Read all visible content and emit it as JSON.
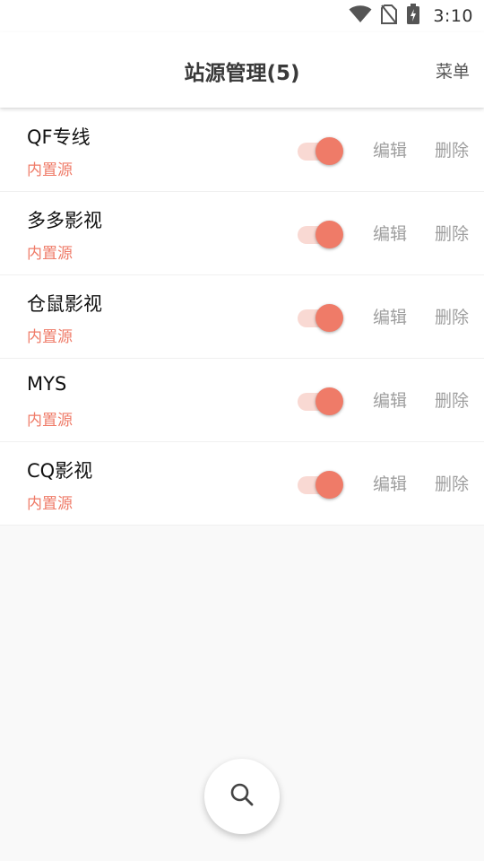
{
  "status_bar": {
    "time": "3:10",
    "icons": [
      "wifi-icon",
      "no-sim-icon",
      "battery-charging-icon"
    ]
  },
  "app_bar": {
    "title": "站源管理(5)",
    "menu_label": "菜单"
  },
  "sources": [
    {
      "name": "QF专线",
      "tag": "内置源",
      "enabled": true,
      "edit_label": "编辑",
      "delete_label": "删除"
    },
    {
      "name": "多多影视",
      "tag": "内置源",
      "enabled": true,
      "edit_label": "编辑",
      "delete_label": "删除"
    },
    {
      "name": "仓鼠影视",
      "tag": "内置源",
      "enabled": true,
      "edit_label": "编辑",
      "delete_label": "删除"
    },
    {
      "name": "MYS",
      "tag": "内置源",
      "enabled": true,
      "edit_label": "编辑",
      "delete_label": "删除"
    },
    {
      "name": "CQ影视",
      "tag": "内置源",
      "enabled": true,
      "edit_label": "编辑",
      "delete_label": "删除"
    }
  ],
  "fab": {
    "icon": "search-icon"
  },
  "colors": {
    "accent": "#ef7b68",
    "accent_light": "#f9d9d3",
    "muted_text": "#9e9e9e",
    "background": "#f9f9f9"
  }
}
